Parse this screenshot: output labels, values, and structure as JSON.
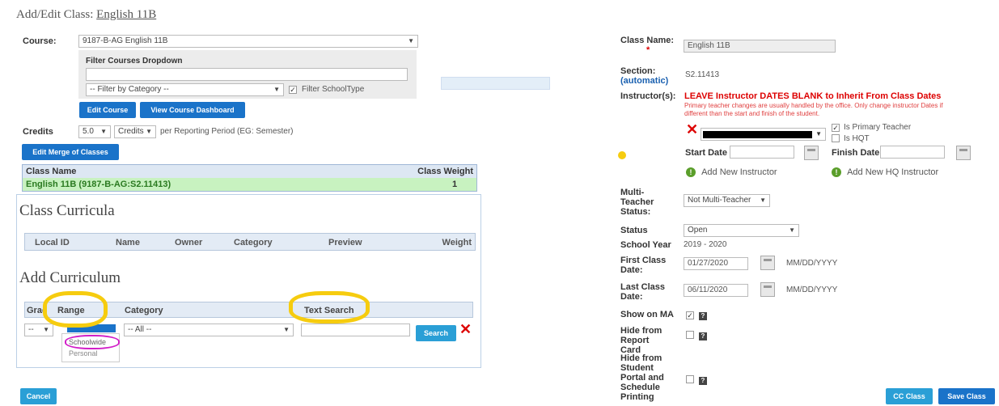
{
  "header": {
    "title_prefix": "Add/Edit Class:",
    "class_name": "English 11B"
  },
  "course": {
    "label": "Course:",
    "selected": "9187-B-AG English 11B",
    "filter_title": "Filter Courses Dropdown",
    "filter_input": "",
    "category_select": "-- Filter by Category --",
    "filter_schooltype_label": "Filter SchoolType",
    "edit_course_btn": "Edit Course",
    "view_dashboard_btn": "View Course Dashboard"
  },
  "credits": {
    "label": "Credits",
    "value": "5.0",
    "unit": "Credits",
    "suffix": "per Reporting Period (EG: Semester)"
  },
  "merge": {
    "edit_btn": "Edit Merge of Classes",
    "col_name": "Class Name",
    "col_weight": "Class Weight",
    "row_name": "English 11B (9187-B-AG:S2.11413)",
    "row_weight": "1"
  },
  "curricula": {
    "title": "Class Curricula",
    "columns": [
      "Local ID",
      "Name",
      "Owner",
      "Category",
      "Preview",
      "Weight"
    ]
  },
  "add_curriculum": {
    "title": "Add Curriculum",
    "col_grade": "Grad",
    "col_range": "Range",
    "col_category": "Category",
    "col_text_search": "Text Search",
    "grade_select": "--",
    "range_options": [
      "Schoolwide",
      "Personal"
    ],
    "category_select": "-- All --",
    "search_btn": "Search"
  },
  "footer": {
    "cancel": "Cancel",
    "cc_class": "CC Class",
    "save_class": "Save Class"
  },
  "right": {
    "class_name_label": "Class Name:",
    "class_name_value": "English 11B",
    "section_label": "Section:",
    "section_auto": "(automatic)",
    "section_value": "S2.11413",
    "instructors_label": "Instructor(s):",
    "instructors_warning": "LEAVE Instructor DATES BLANK to Inherit From Class Dates",
    "instructors_note": "Primary teacher changes are usually handled by the office. Only change instructor Dates if different than the start and finish of the student.",
    "primary_teacher": "Is Primary Teacher",
    "is_hqt": "Is HQT",
    "start_date": "Start Date",
    "finish_date": "Finish Date",
    "add_instructor": "Add New Instructor",
    "add_hq_instructor": "Add New HQ Instructor",
    "multi_teacher_label": "Multi-Teacher Status:",
    "multi_teacher_value": "Not Multi-Teacher",
    "status_label": "Status",
    "status_value": "Open",
    "school_year_label": "School Year",
    "school_year_value": "2019 - 2020",
    "first_date_label": "First Class Date:",
    "first_date_value": "01/27/2020",
    "last_date_label": "Last Class Date:",
    "last_date_value": "06/11/2020",
    "date_format": "MM/DD/YYYY",
    "show_on_ma": "Show on MA",
    "hide_report_card": "Hide from Report Card",
    "hide_student_portal": "Hide from Student Portal and Schedule Printing"
  },
  "colors": {
    "accent": "#1a73c9",
    "highlight_yellow": "#f6cc0f",
    "highlight_magenta": "#d21fc8",
    "warning": "#d00000"
  }
}
